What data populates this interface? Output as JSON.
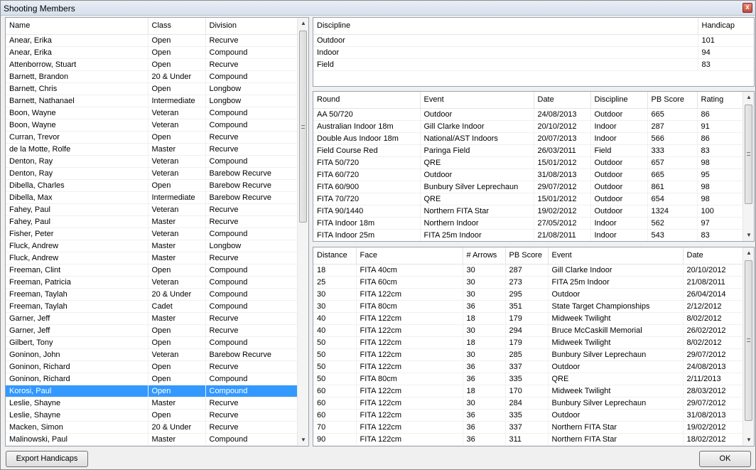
{
  "window": {
    "title": "Shooting Members",
    "close_glyph": "x"
  },
  "members": {
    "columns": [
      "Name",
      "Class",
      "Division"
    ],
    "selected_index": 29,
    "rows": [
      [
        "Anear, Erika",
        "Open",
        "Recurve"
      ],
      [
        "Anear, Erika",
        "Open",
        "Compound"
      ],
      [
        "Attenborrow, Stuart",
        "Open",
        "Recurve"
      ],
      [
        "Barnett, Brandon",
        "20 & Under",
        "Compound"
      ],
      [
        "Barnett, Chris",
        "Open",
        "Longbow"
      ],
      [
        "Barnett, Nathanael",
        "Intermediate",
        "Longbow"
      ],
      [
        "Boon, Wayne",
        "Veteran",
        "Compound"
      ],
      [
        "Boon, Wayne",
        "Veteran",
        "Compound"
      ],
      [
        "Curran, Trevor",
        "Open",
        "Recurve"
      ],
      [
        "de la Motte, Rolfe",
        "Master",
        "Recurve"
      ],
      [
        "Denton, Ray",
        "Veteran",
        "Compound"
      ],
      [
        "Denton, Ray",
        "Veteran",
        "Barebow Recurve"
      ],
      [
        "Dibella, Charles",
        "Open",
        "Barebow Recurve"
      ],
      [
        "Dibella, Max",
        "Intermediate",
        "Barebow Recurve"
      ],
      [
        "Fahey, Paul",
        "Veteran",
        "Recurve"
      ],
      [
        "Fahey, Paul",
        "Master",
        "Recurve"
      ],
      [
        "Fisher, Peter",
        "Veteran",
        "Compound"
      ],
      [
        "Fluck, Andrew",
        "Master",
        "Longbow"
      ],
      [
        "Fluck, Andrew",
        "Master",
        "Recurve"
      ],
      [
        "Freeman, Clint",
        "Open",
        "Compound"
      ],
      [
        "Freeman, Patricia",
        "Veteran",
        "Compound"
      ],
      [
        "Freeman, Taylah",
        "20 & Under",
        "Compound"
      ],
      [
        "Freeman, Taylah",
        "Cadet",
        "Compound"
      ],
      [
        "Garner, Jeff",
        "Master",
        "Recurve"
      ],
      [
        "Garner, Jeff",
        "Open",
        "Recurve"
      ],
      [
        "Gilbert, Tony",
        "Open",
        "Compound"
      ],
      [
        "Goninon, John",
        "Veteran",
        "Barebow Recurve"
      ],
      [
        "Goninon, Richard",
        "Open",
        "Recurve"
      ],
      [
        "Goninon, Richard",
        "Open",
        "Compound"
      ],
      [
        "Korosi, Paul",
        "Open",
        "Compound"
      ],
      [
        "Leslie, Shayne",
        "Master",
        "Recurve"
      ],
      [
        "Leslie, Shayne",
        "Open",
        "Recurve"
      ],
      [
        "Macken, Simon",
        "20 & Under",
        "Recurve"
      ],
      [
        "Malinowski, Paul",
        "Master",
        "Compound"
      ]
    ]
  },
  "handicaps": {
    "columns": [
      "Discipline",
      "Handicap"
    ],
    "rows": [
      [
        "Outdoor",
        "101"
      ],
      [
        "Indoor",
        "94"
      ],
      [
        "Field",
        "83"
      ]
    ]
  },
  "rounds": {
    "columns": [
      "Round",
      "Event",
      "Date",
      "Discipline",
      "PB Score",
      "Rating"
    ],
    "rows": [
      [
        "AA 50/720",
        "Outdoor",
        "24/08/2013",
        "Outdoor",
        "665",
        "86"
      ],
      [
        "Australian Indoor 18m",
        "Gill Clarke Indoor",
        "20/10/2012",
        "Indoor",
        "287",
        "91"
      ],
      [
        "Double Aus Indoor 18m",
        "National/AST Indoors",
        "20/07/2013",
        "Indoor",
        "566",
        "86"
      ],
      [
        "Field Course Red",
        "Paringa Field",
        "26/03/2011",
        "Field",
        "333",
        "83"
      ],
      [
        "FITA 50/720",
        "QRE",
        "15/01/2012",
        "Outdoor",
        "657",
        "98"
      ],
      [
        "FITA 60/720",
        "Outdoor",
        "31/08/2013",
        "Outdoor",
        "665",
        "95"
      ],
      [
        "FITA 60/900",
        "Bunbury Silver Leprechaun",
        "29/07/2012",
        "Outdoor",
        "861",
        "98"
      ],
      [
        "FITA 70/720",
        "QRE",
        "15/01/2012",
        "Outdoor",
        "654",
        "98"
      ],
      [
        "FITA 90/1440",
        "Northern FITA Star",
        "19/02/2012",
        "Outdoor",
        "1324",
        "100"
      ],
      [
        "FITA Indoor 18m",
        "Northern Indoor",
        "27/05/2012",
        "Indoor",
        "562",
        "97"
      ],
      [
        "FITA Indoor 25m",
        "FITA 25m Indoor",
        "21/08/2011",
        "Indoor",
        "543",
        "83"
      ]
    ]
  },
  "distances": {
    "columns": [
      "Distance",
      "Face",
      "# Arrows",
      "PB Score",
      "Event",
      "Date"
    ],
    "rows": [
      [
        "18",
        "FITA 40cm",
        "30",
        "287",
        "Gill Clarke Indoor",
        "20/10/2012"
      ],
      [
        "25",
        "FITA 60cm",
        "30",
        "273",
        "FITA 25m Indoor",
        "21/08/2011"
      ],
      [
        "30",
        "FITA 122cm",
        "30",
        "295",
        "Outdoor",
        "26/04/2014"
      ],
      [
        "30",
        "FITA 80cm",
        "36",
        "351",
        "State Target Championships",
        "2/12/2012"
      ],
      [
        "40",
        "FITA 122cm",
        "18",
        "179",
        "Midweek Twilight",
        "8/02/2012"
      ],
      [
        "40",
        "FITA 122cm",
        "30",
        "294",
        "Bruce McCaskill Memorial",
        "26/02/2012"
      ],
      [
        "50",
        "FITA 122cm",
        "18",
        "179",
        "Midweek Twilight",
        "8/02/2012"
      ],
      [
        "50",
        "FITA 122cm",
        "30",
        "285",
        "Bunbury Silver Leprechaun",
        "29/07/2012"
      ],
      [
        "50",
        "FITA 122cm",
        "36",
        "337",
        "Outdoor",
        "24/08/2013"
      ],
      [
        "50",
        "FITA 80cm",
        "36",
        "335",
        "QRE",
        "2/11/2013"
      ],
      [
        "60",
        "FITA 122cm",
        "18",
        "170",
        "Midweek Twilight",
        "28/03/2012"
      ],
      [
        "60",
        "FITA 122cm",
        "30",
        "284",
        "Bunbury Silver Leprechaun",
        "29/07/2012"
      ],
      [
        "60",
        "FITA 122cm",
        "36",
        "335",
        "Outdoor",
        "31/08/2013"
      ],
      [
        "70",
        "FITA 122cm",
        "36",
        "337",
        "Northern FITA Star",
        "19/02/2012"
      ],
      [
        "90",
        "FITA 122cm",
        "36",
        "311",
        "Northern FITA Star",
        "18/02/2012"
      ]
    ]
  },
  "buttons": {
    "export": "Export Handicaps",
    "ok": "OK"
  },
  "colors": {
    "selection": "#3399ff",
    "selection_text": "#ffffff"
  }
}
